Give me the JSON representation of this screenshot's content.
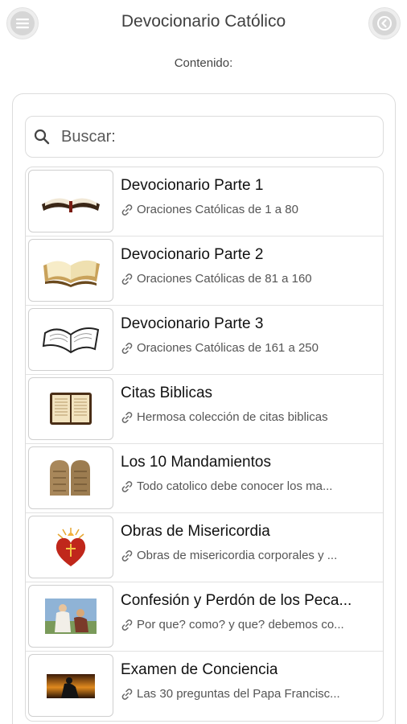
{
  "header": {
    "title": "Devocionario Católico",
    "menu_icon": "hamburger-menu-icon",
    "back_icon": "back-arrow-icon"
  },
  "subtitle": "Contenido:",
  "search": {
    "placeholder": "Buscar:"
  },
  "items": [
    {
      "title": "Devocionario Parte 1",
      "subtitle": "Oraciones Católicas de 1 a 80",
      "icon": "open-bible-icon"
    },
    {
      "title": "Devocionario Parte 2",
      "subtitle": "Oraciones Católicas de 81 a 160",
      "icon": "open-book-icon"
    },
    {
      "title": "Devocionario Parte 3",
      "subtitle": "Oraciones Católicas de 161 a 250",
      "icon": "open-book-icon"
    },
    {
      "title": "Citas Biblicas",
      "subtitle": "Hermosa colección de citas biblicas",
      "icon": "scripture-book-icon"
    },
    {
      "title": "Los 10 Mandamientos",
      "subtitle": "Todo catolico debe conocer los ma...",
      "icon": "stone-tablets-icon"
    },
    {
      "title": "Obras de Misericordia",
      "subtitle": "Obras de misericordia corporales y ...",
      "icon": "sacred-heart-icon"
    },
    {
      "title": "Confesión y Perdón de los Peca...",
      "subtitle": "Por que? como? y que? debemos co...",
      "icon": "confession-scene-icon"
    },
    {
      "title": "Examen de Conciencia",
      "subtitle": "Las 30 preguntas del Papa Francisc...",
      "icon": "praying-silhouette-icon"
    }
  ],
  "colors": {
    "text": "#111111",
    "subtext": "#555555",
    "border": "#dcdcdc"
  }
}
